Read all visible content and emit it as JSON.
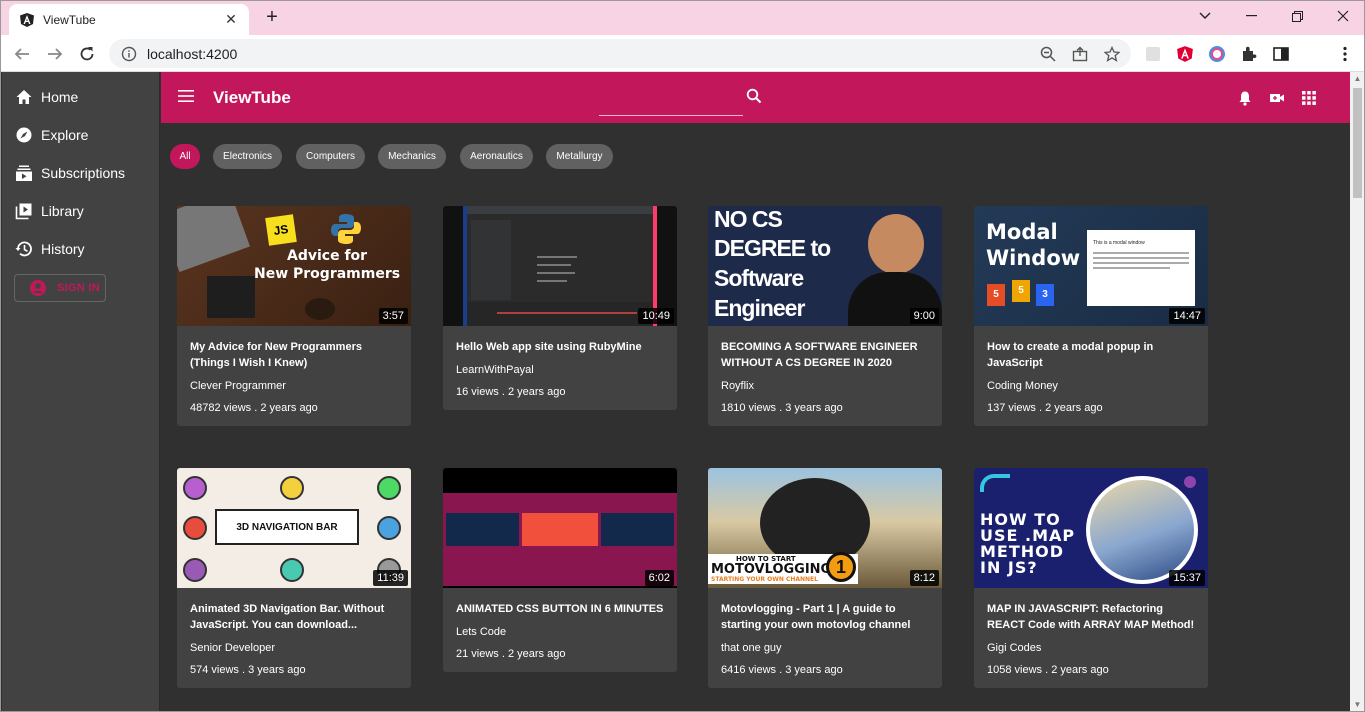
{
  "browser": {
    "tab_title": "ViewTube",
    "url": "localhost:4200"
  },
  "sidebar": {
    "items": [
      {
        "label": "Home",
        "icon": "home-icon"
      },
      {
        "label": "Explore",
        "icon": "explore-icon"
      },
      {
        "label": "Subscriptions",
        "icon": "subscriptions-icon"
      },
      {
        "label": "Library",
        "icon": "library-icon"
      },
      {
        "label": "History",
        "icon": "history-icon"
      }
    ],
    "signin_label": "SIGN IN"
  },
  "header": {
    "brand": "ViewTube"
  },
  "chips": [
    "All",
    "Electronics",
    "Computers",
    "Mechanics",
    "Aeronautics",
    "Metallurgy"
  ],
  "videos": [
    {
      "title": "My Advice for New Programmers (Things I Wish I Knew)",
      "channel": "Clever Programmer",
      "meta": "48782 views . 2 years ago",
      "duration": "3:57",
      "thumb_text": [
        "Advice for",
        "New Programmers",
        "JS"
      ]
    },
    {
      "title": "Hello Web app site using RubyMine",
      "channel": "LearnWithPayal",
      "meta": "16 views . 2 years ago",
      "duration": "10:49"
    },
    {
      "title": "BECOMING A SOFTWARE ENGINEER WITHOUT A CS DEGREE IN 2020",
      "channel": "Royflix",
      "meta": "1810 views . 3 years ago",
      "duration": "9:00",
      "thumb_text": [
        "NO CS",
        "DEGREE to",
        "Software",
        "Engineer"
      ]
    },
    {
      "title": "How to create a modal popup in JavaScript",
      "channel": "Coding Money",
      "meta": "137 views . 2 years ago",
      "duration": "14:47",
      "thumb_text": [
        "Modal",
        "Window",
        "This is a modal window"
      ]
    },
    {
      "title": "Animated 3D Navigation Bar. Without JavaScript. You can download...",
      "channel": "Senior Developer",
      "meta": "574 views . 3 years ago",
      "duration": "11:39",
      "thumb_text": [
        "3D NAVIGATION BAR"
      ]
    },
    {
      "title": "ANIMATED CSS BUTTON IN 6 MINUTES",
      "channel": "Lets Code",
      "meta": "21 views . 2 years ago",
      "duration": "6:02"
    },
    {
      "title": "Motovlogging - Part 1 | A guide to starting your own motovlog channel",
      "channel": "that one guy",
      "meta": "6416 views . 3 years ago",
      "duration": "8:12",
      "thumb_text": [
        "HOW TO START",
        "MOTOVLOGGING",
        "STARTING YOUR OWN CHANNEL",
        "1"
      ]
    },
    {
      "title": "MAP IN JAVASCRIPT: Refactoring REACT Code with ARRAY MAP Method!",
      "channel": "Gigi Codes",
      "meta": "1058 views . 2 years ago",
      "duration": "15:37",
      "thumb_text": [
        "HOW TO",
        "USE .MAP",
        "METHOD",
        "IN JS?"
      ]
    }
  ],
  "colors": {
    "accent": "#c2185b",
    "surface": "#424242",
    "background": "#303030"
  }
}
